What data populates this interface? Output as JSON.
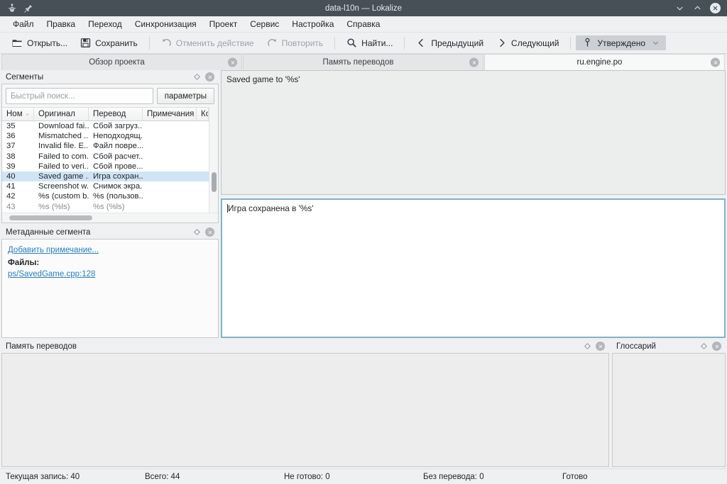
{
  "window": {
    "title": "data-l10n — Lokalize",
    "icons": {
      "app": "app-icon",
      "pin": "pin-icon"
    },
    "controls": {
      "minimize": "⌄",
      "maximize": "⌃",
      "close": "✕"
    }
  },
  "menubar": {
    "items": [
      {
        "label": "Файл"
      },
      {
        "label": "Правка"
      },
      {
        "label": "Переход"
      },
      {
        "label": "Синхронизация"
      },
      {
        "label": "Проект"
      },
      {
        "label": "Сервис"
      },
      {
        "label": "Настройка"
      },
      {
        "label": "Справка"
      }
    ]
  },
  "toolbar": {
    "open_label": "Открыть...",
    "save_label": "Сохранить",
    "undo_label": "Отменить действие",
    "redo_label": "Повторить",
    "find_label": "Найти...",
    "prev_label": "Предыдущий",
    "next_label": "Следующий",
    "approved_label": "Утверждено"
  },
  "tabs": [
    {
      "label": "Обзор проекта",
      "active": false
    },
    {
      "label": "Память переводов",
      "active": false
    },
    {
      "label": "ru.engine.po",
      "active": true
    }
  ],
  "segments_panel": {
    "title": "Сегменты",
    "search_placeholder": "Быстрый поиск...",
    "search_value": "",
    "params_label": "параметры",
    "columns": [
      "Ном",
      "Оригинал",
      "Перевод",
      "Примечания",
      "Ко"
    ],
    "sort_column": "Ном",
    "rows": [
      {
        "num": "35",
        "original": "Download fai...",
        "translation": "Сбой загруз...",
        "notes": "",
        "selected": false
      },
      {
        "num": "36",
        "original": "Mismatched ...",
        "translation": "Неподходящ...",
        "notes": "",
        "selected": false
      },
      {
        "num": "37",
        "original": "Invalid file. E...",
        "translation": "Файл повре...",
        "notes": "",
        "selected": false
      },
      {
        "num": "38",
        "original": "Failed to com...",
        "translation": "Сбой расчет...",
        "notes": "",
        "selected": false
      },
      {
        "num": "39",
        "original": "Failed to veri...",
        "translation": "Сбой прове...",
        "notes": "",
        "selected": false
      },
      {
        "num": "40",
        "original": "Saved game ...",
        "translation": "Игра сохран...",
        "notes": "",
        "selected": true
      },
      {
        "num": "41",
        "original": "Screenshot w...",
        "translation": "Снимок экра...",
        "notes": "",
        "selected": false
      },
      {
        "num": "42",
        "original": "%s (custom b...",
        "translation": "%s (пользов...",
        "notes": "",
        "selected": false
      },
      {
        "num": "43",
        "original": "%s (%ls)",
        "translation": "%s (%ls)",
        "notes": "",
        "selected": false
      }
    ]
  },
  "metadata_panel": {
    "title": "Метаданные сегмента",
    "add_note_label": "Добавить примечание...",
    "files_label": "Файлы:",
    "file_ref": "ps/SavedGame.cpp:128"
  },
  "editor": {
    "source_text": "Saved game to '%s'",
    "target_text": "Игра сохранена в '%s'"
  },
  "tm_panel": {
    "title": "Память переводов"
  },
  "glossary_panel": {
    "title": "Глоссарий"
  },
  "statusbar": {
    "current": "Текущая запись: 40",
    "total": "Всего: 44",
    "not_ready": "Не готово: 0",
    "untranslated": "Без перевода: 0",
    "ready": "Готово"
  },
  "colors": {
    "titlebar": "#475057",
    "window": "#eff0f1",
    "selection": "#cfe4f4",
    "link": "#2980b9",
    "focus_border": "#7fb4cb"
  }
}
